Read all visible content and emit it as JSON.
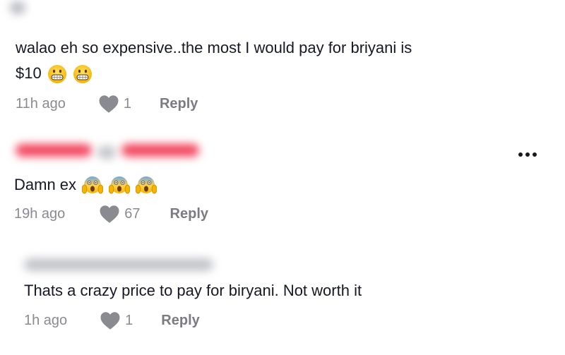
{
  "comments": [
    {
      "text": "walao eh so expensive..the most I would pay for briyani is",
      "text_line2": "$10",
      "emojis": [
        "grimacing-face-emoji",
        "grimacing-face-emoji"
      ],
      "timestamp": "11h ago",
      "likes": "1",
      "reply_label": "Reply",
      "username_blur_color": "#b9bbc2"
    },
    {
      "text": "Damn ex",
      "emojis": [
        "face-screaming-in-fear-emoji",
        "face-screaming-in-fear-emoji",
        "face-screaming-in-fear-emoji"
      ],
      "timestamp": "19h ago",
      "likes": "67",
      "reply_label": "Reply",
      "username_blur_color": "#f2455d"
    },
    {
      "text": "Thats a crazy price to pay for biryani. Not worth it",
      "emojis": [],
      "timestamp": "1h ago",
      "likes": "1",
      "reply_label": "Reply",
      "username_blur_color": "#b9bbc2"
    }
  ],
  "colors": {
    "text": "#161823",
    "meta": "#8a8b91",
    "heart": "#8a8b91",
    "reply": "#7b7c82"
  },
  "icons": {
    "like": "heart-icon",
    "more": "more-options-icon"
  }
}
